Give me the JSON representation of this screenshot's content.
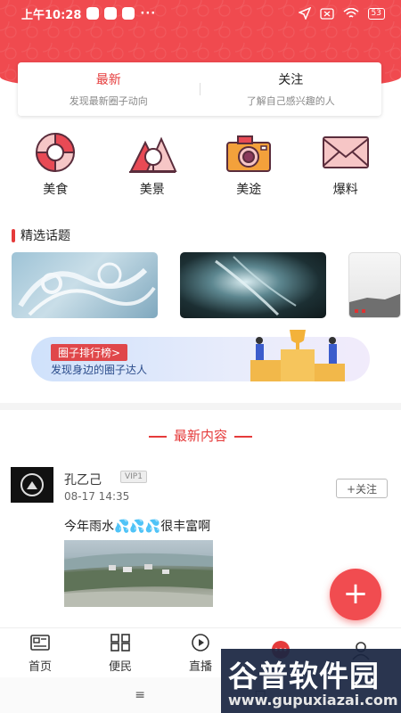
{
  "status": {
    "time": "上午10:28",
    "more": "···",
    "battery": "53"
  },
  "tabs": [
    {
      "title": "最新",
      "subtitle": "发现最新圈子动向"
    },
    {
      "title": "关注",
      "subtitle": "了解自己感兴趣的人"
    }
  ],
  "categories": [
    {
      "label": "美食",
      "icon": "lifebuoy-icon"
    },
    {
      "label": "美景",
      "icon": "landscape-icon"
    },
    {
      "label": "美途",
      "icon": "camera-icon"
    },
    {
      "label": "爆料",
      "icon": "mail-icon"
    }
  ],
  "featured": {
    "title": "精选话题"
  },
  "ranking": {
    "tag": "圈子排行榜>",
    "subtitle": "发现身边的圈子达人"
  },
  "latest": {
    "title": "最新内容"
  },
  "post": {
    "username": "孔乙己",
    "vip": "VIP1",
    "time": "08-17 14:35",
    "follow": "+关注",
    "text_before": "今年雨水",
    "emoji": "💦💦💦",
    "text_after": "很丰富啊"
  },
  "fab": {
    "label": "+"
  },
  "nav": [
    {
      "label": "首页",
      "icon": "news-icon"
    },
    {
      "label": "便民",
      "icon": "grid-icon"
    },
    {
      "label": "直播",
      "icon": "play-icon"
    },
    {
      "label": "",
      "icon": "chat-icon"
    },
    {
      "label": "",
      "icon": "user-icon"
    }
  ],
  "system_nav": {
    "menu": "≡",
    "home": "□"
  },
  "watermark": {
    "line1": "谷普软件园",
    "line2": "www.gupuxiazai.com"
  },
  "colors": {
    "accent": "#e53b3b",
    "header": "#f04a4f"
  }
}
